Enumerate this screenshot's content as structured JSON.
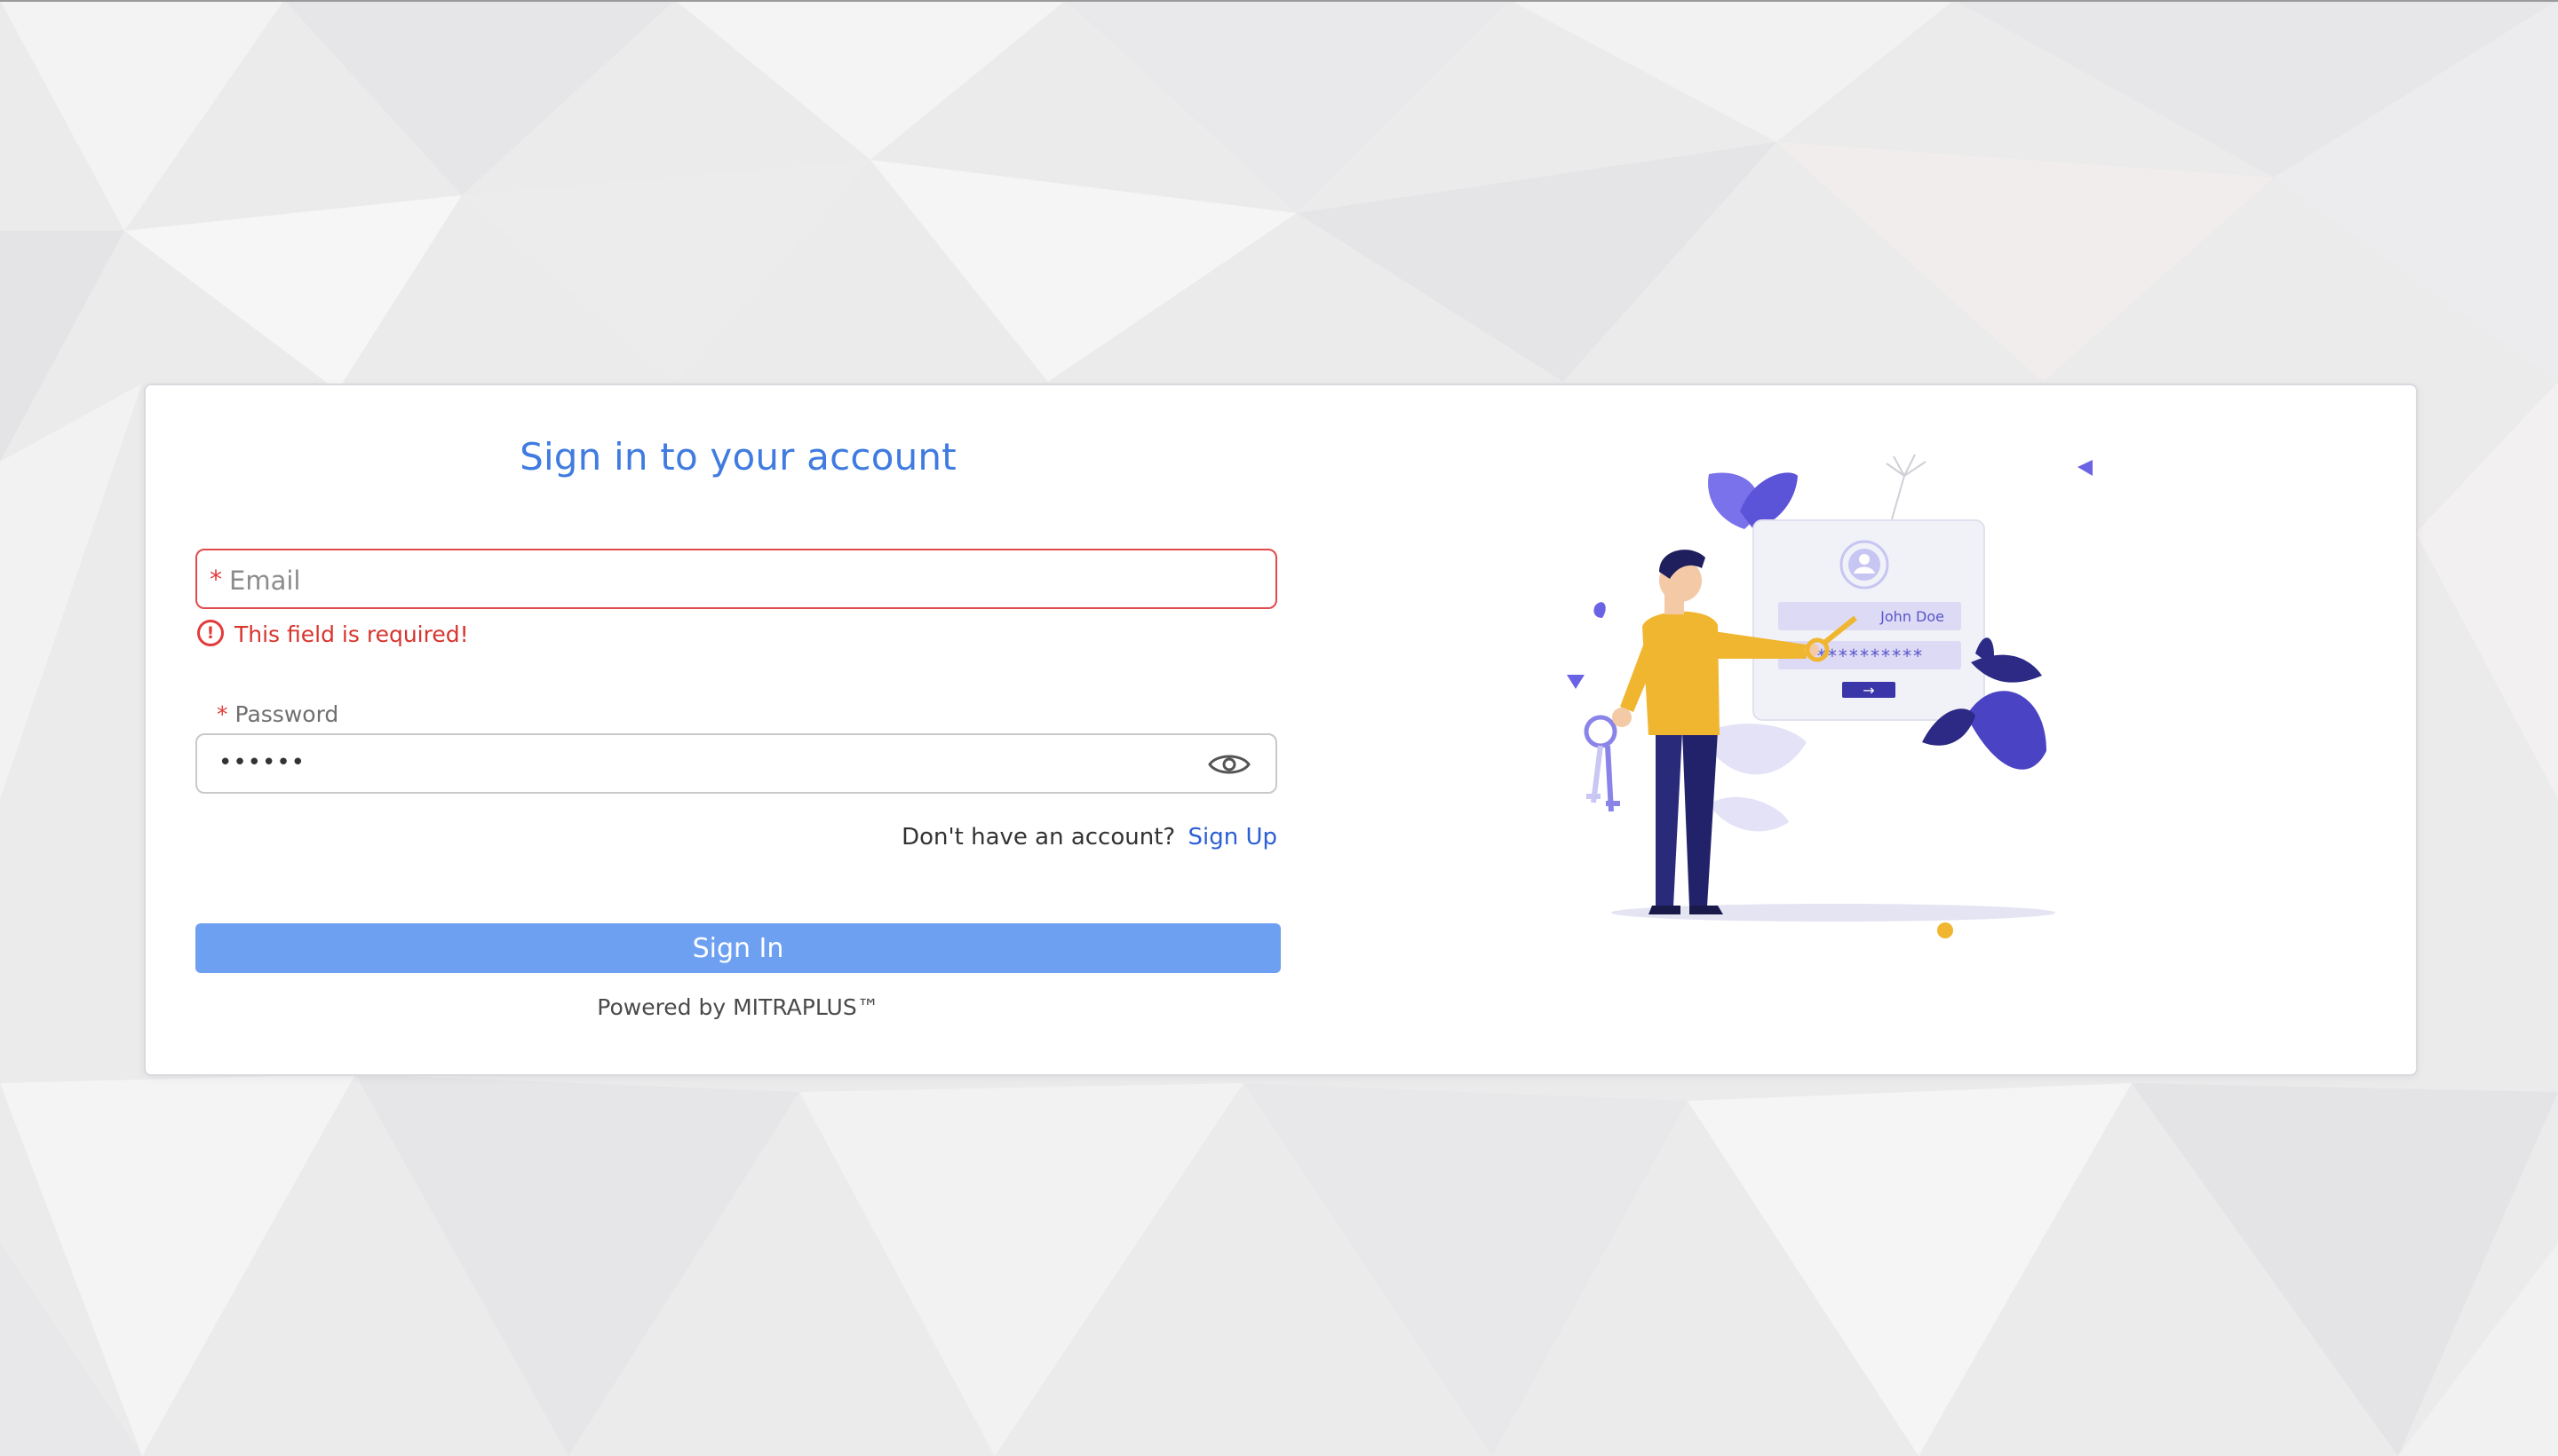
{
  "form": {
    "title": "Sign in to your account",
    "email": {
      "required_marker": "*",
      "placeholder": "Email",
      "value": "",
      "error": "This field is required!"
    },
    "password": {
      "required_marker": "*",
      "label": "Password",
      "value": "••••••"
    },
    "signup_prompt": "Don't have an account?",
    "signup_link": "Sign Up",
    "submit_label": "Sign In",
    "powered_by": "Powered by MITRAPLUS™"
  },
  "illustration": {
    "username": "John Doe",
    "password_mask": "**********",
    "arrow": "→"
  },
  "colors": {
    "accent": "#3f7be0",
    "button": "#6ea0f2",
    "error": "#e23b3b",
    "illustration_purple": "#6b63e6",
    "illustration_navy": "#2a2a7a",
    "illustration_yellow": "#f0b630"
  },
  "icons": {
    "error": "exclamation-circle-icon",
    "password_toggle": "eye-icon"
  }
}
